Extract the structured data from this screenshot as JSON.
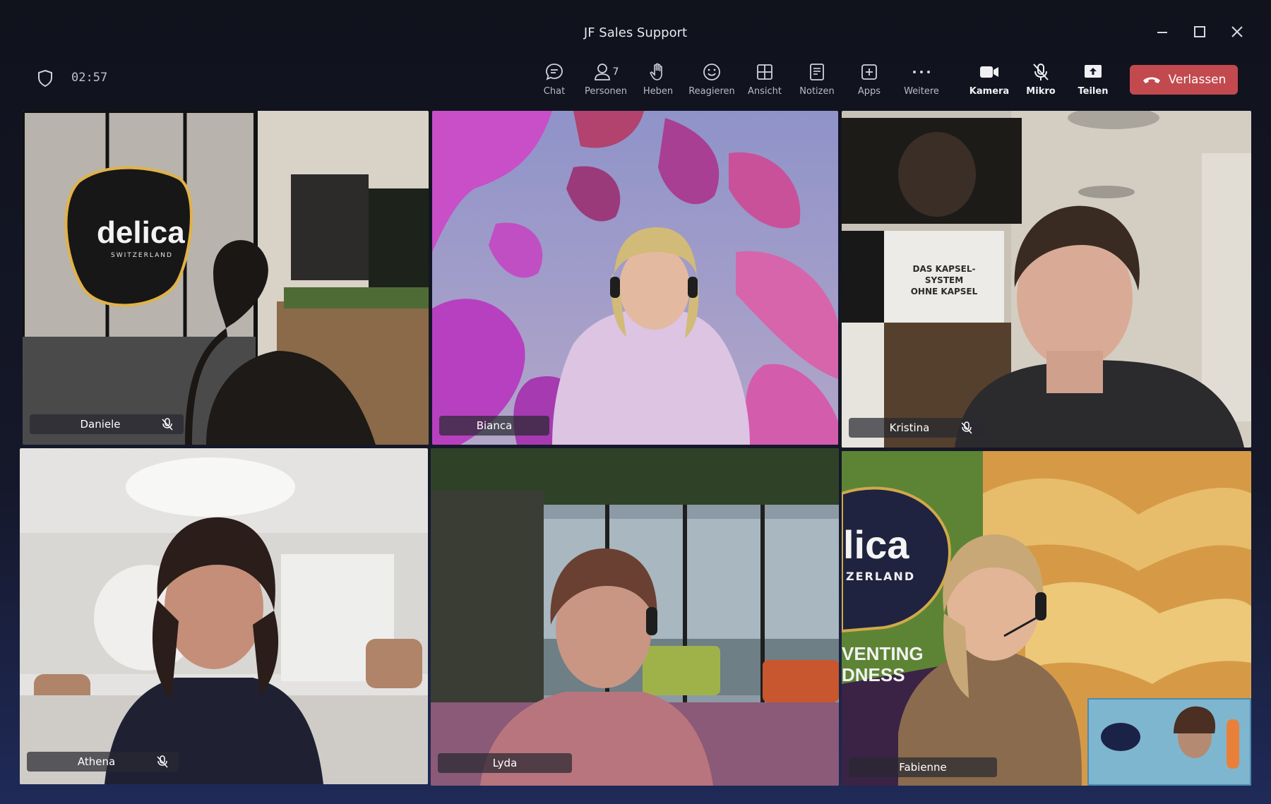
{
  "window": {
    "title": "JF Sales Support"
  },
  "meeting": {
    "timer": "02:57"
  },
  "toolbar": {
    "chat": "Chat",
    "people": "Personen",
    "people_count": "7",
    "raise": "Heben",
    "react": "Reagieren",
    "view": "Ansicht",
    "notes": "Notizen",
    "apps": "Apps",
    "more": "Weitere",
    "camera": "Kamera",
    "mic": "Mikro",
    "share": "Teilen",
    "leave": "Verlassen"
  },
  "participants": [
    {
      "name": "Daniele",
      "muted": true
    },
    {
      "name": "Bianca",
      "muted": false
    },
    {
      "name": "Kristina",
      "muted": true
    },
    {
      "name": "Athena",
      "muted": true
    },
    {
      "name": "Lyda",
      "muted": false
    },
    {
      "name": "Fabienne",
      "muted": false,
      "active_speaker": true
    }
  ],
  "backgrounds": {
    "logo_text": "delica",
    "logo_sub": "SWITZERLAND",
    "poster_text": [
      "DAS KAPSEL-",
      "SYSTEM",
      "OHNE KAPSEL"
    ],
    "banner_logo": "lica",
    "banner_sub": "ZERLAND",
    "banner_line1": "VENTING",
    "banner_line2": "DNESS"
  },
  "colors": {
    "leave_button": "#c24a4f",
    "active_border": "#6f73d8"
  }
}
